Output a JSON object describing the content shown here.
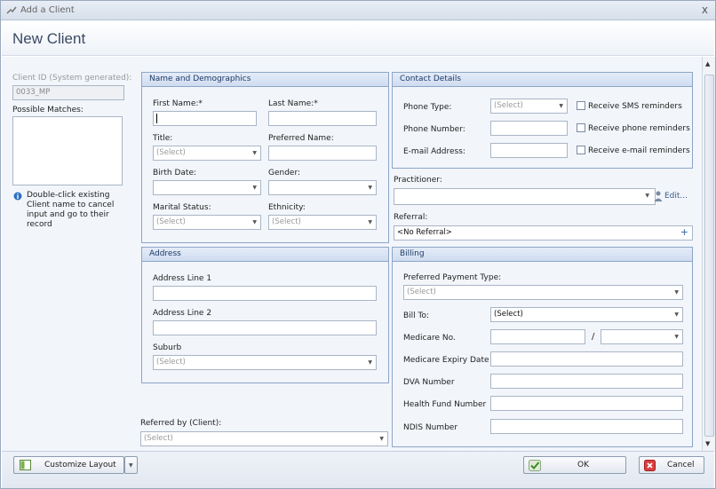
{
  "window": {
    "title": "Add a Client",
    "close_label": "x"
  },
  "header": {
    "title": "New Client"
  },
  "left": {
    "client_id_label": "Client ID (System generated):",
    "client_id_value": "0033_MP",
    "possible_matches_label": "Possible Matches:",
    "hint": "Double-click existing Client name to cancel input and go to their record",
    "referred_by_label": "Referred by (Client):",
    "referred_by_value": "(Select)"
  },
  "name_demo": {
    "title": "Name and Demographics",
    "first_name_label": "First Name:*",
    "last_name_label": "Last Name:*",
    "title_label": "Title:",
    "title_value": "(Select)",
    "preferred_name_label": "Preferred Name:",
    "birth_date_label": "Birth Date:",
    "gender_label": "Gender:",
    "marital_label": "Marital Status:",
    "marital_value": "(Select)",
    "ethnicity_label": "Ethnicity:",
    "ethnicity_value": "(Select)"
  },
  "address": {
    "title": "Address",
    "line1_label": "Address Line 1",
    "line2_label": "Address Line 2",
    "suburb_label": "Suburb",
    "suburb_value": "(Select)"
  },
  "contact": {
    "title": "Contact Details",
    "phone_type_label": "Phone Type:",
    "phone_type_value": "(Select)",
    "phone_number_label": "Phone Number:",
    "email_label": "E-mail Address:",
    "sms_label": "Receive SMS reminders",
    "phone_rem_label": "Receive phone reminders",
    "email_rem_label": "Receive e-mail reminders",
    "practitioner_label": "Practitioner:",
    "edit_label": "Edit...",
    "referral_label": "Referral:",
    "referral_value": "<No Referral>",
    "referral_add": "+"
  },
  "billing": {
    "title": "Billing",
    "payment_label": "Preferred Payment Type:",
    "payment_value": "(Select)",
    "bill_to_label": "Bill To:",
    "bill_to_value": "(Select)",
    "medicare_label": "Medicare No.",
    "medicare_sep": "/",
    "medicare_expiry_label": "Medicare Expiry Date",
    "dva_label": "DVA Number",
    "health_fund_label": "Health Fund Number",
    "ndis_label": "NDIS Number"
  },
  "footer": {
    "customize_label": "Customize Layout",
    "ok_label": "OK",
    "cancel_label": "Cancel"
  },
  "colors": {
    "panel_header": "#cfdcf0",
    "panel_border": "#8da5c8",
    "title_text": "#3a4a63"
  }
}
